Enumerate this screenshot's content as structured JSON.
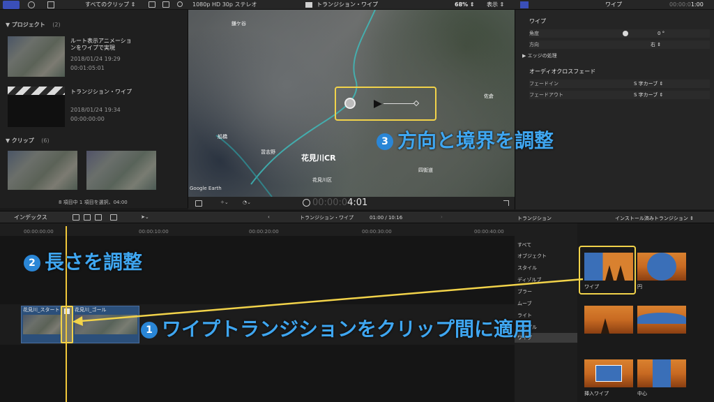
{
  "browser": {
    "dropdown": "すべてのクリップ ⇕",
    "projects_header": "プロジェクト",
    "projects_count": "(2)",
    "projects": [
      {
        "title": "ルート表示アニメーションをワイプで実現",
        "date": "2018/01/24 19:29",
        "duration": "00:01:05:01"
      },
      {
        "title": "トランジション・ワイプ",
        "date": "2018/01/24 19:34",
        "duration": "00:00:00:00"
      }
    ],
    "clips_header": "クリップ",
    "clips_count": "(6)",
    "clip_label_1": "花見川_スタート",
    "clip_label_2": "花見川_ゴール",
    "status": "8 項目中 1 項目を選択、04:00"
  },
  "viewer": {
    "format": "1080p HD 30p ステレオ",
    "title": "トランジション・ワイプ",
    "zoom": "68% ⇕",
    "view": "表示 ⇕",
    "timecode_dim": "00:00:0",
    "timecode_bright": "4:01",
    "map_labels": [
      "鎌ケ谷",
      "佐倉",
      "船橋",
      "習志野",
      "花見川CR",
      "花見川区",
      "四街道",
      "Google Earth"
    ]
  },
  "inspector": {
    "title": "ワイプ",
    "timecode_dim": "00:00:0",
    "timecode_bright": "1:00",
    "section1": "ワイプ",
    "angle_label": "角度",
    "angle_value": "0 °",
    "direction_label": "方向",
    "direction_value": "右 ⇕",
    "edge_label": "エッジの処理",
    "section2": "オーディオクロスフェード",
    "fadein_label": "フェードイン",
    "fadein_value": "S 字カーブ ⇕",
    "fadeout_label": "フェードアウト",
    "fadeout_value": "S 字カーブ ⇕"
  },
  "timeline": {
    "index_label": "インデックス",
    "title": "トランジション・ワイプ",
    "position": "01:00 / 10:16",
    "ruler": [
      "00:00:00:00",
      "00:00:10:00",
      "00:00:20:00",
      "00:00:30:00",
      "00:00:40:00"
    ]
  },
  "transitions": {
    "header": "トランジション",
    "installed": "インストール済みトランジション ⇕",
    "categories": [
      "すべて",
      "オブジェクト",
      "スタイル",
      "ディゾルブ",
      "ブラー",
      "ムーブ",
      "ライト",
      "リップル",
      "ワイプ"
    ],
    "thumbs": [
      "ワイプ",
      "円",
      "",
      "",
      "挿入ワイプ",
      "中心"
    ]
  },
  "annotations": {
    "step1": "ワイプトランジションをクリップ間に適用",
    "step2": "長さを調整",
    "step3": "方向と境界を調整",
    "num1": "1",
    "num2": "2",
    "num3": "3"
  }
}
